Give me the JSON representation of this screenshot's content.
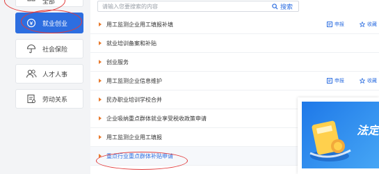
{
  "sidebar": {
    "items": [
      {
        "label": "全部",
        "icon": "grid-icon"
      },
      {
        "label": "就业创业",
        "icon": "coin-icon",
        "active": true
      },
      {
        "label": "社会保险",
        "icon": "umbrella-icon"
      },
      {
        "label": "人才人事",
        "icon": "people-icon"
      },
      {
        "label": "劳动关系",
        "icon": "document-icon"
      }
    ]
  },
  "search": {
    "placeholder": "请输入您要搜索的内容",
    "button": "搜索"
  },
  "actions": {
    "apply": "申报",
    "favorite": "收藏"
  },
  "list": [
    "用工监测企业用工填报补填",
    "就业培训备案和补贴",
    "创业服务",
    "用工监测企业信息维护",
    "民办职业培训学校合并",
    "企业吸纳重点群体就业享受税收政策申请",
    "用工监测企业用工填报",
    "重点行业重点群体补贴申请"
  ],
  "banner": {
    "title": "法定"
  },
  "colors": {
    "accent": "#2d6ee0",
    "bullet": "#e8792b",
    "annotation": "#e23b3b"
  }
}
